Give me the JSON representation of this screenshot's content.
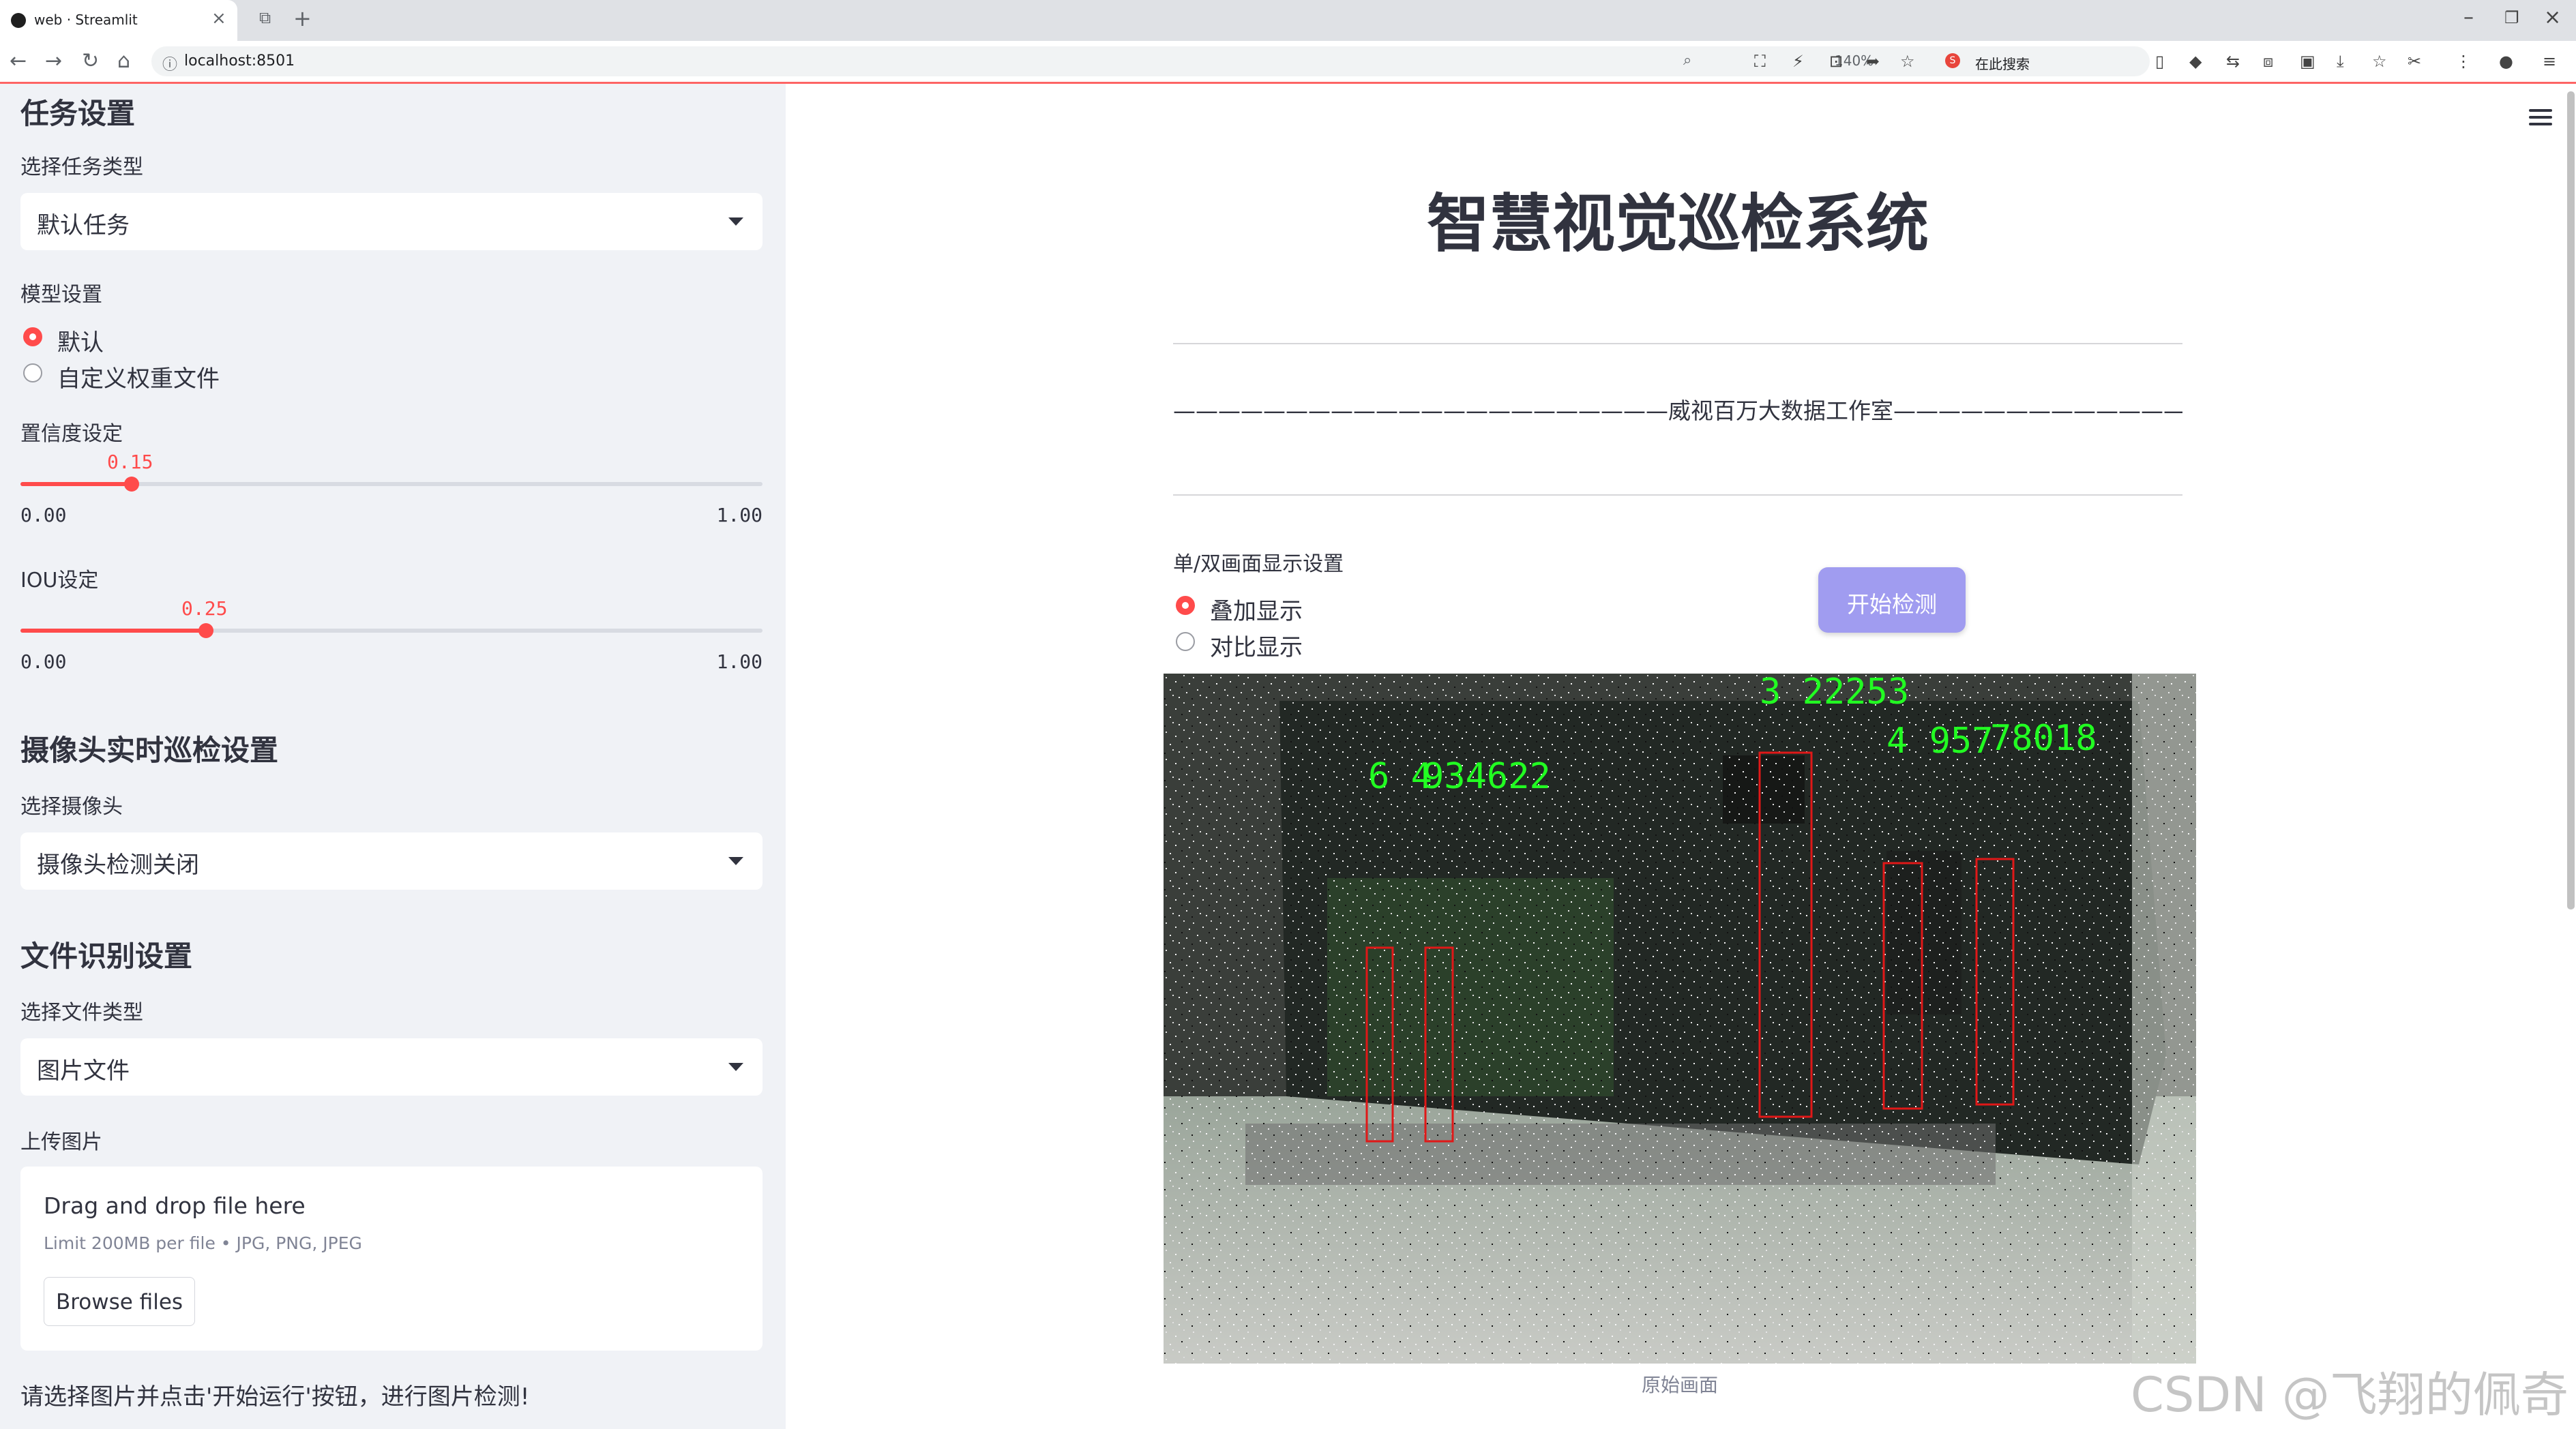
{
  "browser": {
    "tab_title": "web · Streamlit",
    "url": "localhost:8501",
    "zoom": "140%",
    "search_label": "在此搜索",
    "search_logo": "S"
  },
  "sidebar": {
    "task_section": {
      "heading": "任务设置",
      "type_label": "选择任务类型",
      "type_value": "默认任务",
      "model_label": "模型设置",
      "model_options": [
        "默认",
        "自定义权重文件"
      ],
      "model_selected": 0
    },
    "confidence": {
      "label": "置信度设定",
      "value": 0.15,
      "value_text": "0.15",
      "min": "0.00",
      "max": "1.00"
    },
    "iou": {
      "label": "IOU设定",
      "value": 0.25,
      "value_text": "0.25",
      "min": "0.00",
      "max": "1.00"
    },
    "camera_section": {
      "heading": "摄像头实时巡检设置",
      "label": "选择摄像头",
      "value": "摄像头检测关闭"
    },
    "file_section": {
      "heading": "文件识别设置",
      "type_label": "选择文件类型",
      "type_value": "图片文件",
      "upload_label": "上传图片",
      "drop_text": "Drag and drop file here",
      "limit_text": "Limit 200MB per file • JPG, PNG, JPEG",
      "browse_label": "Browse files"
    },
    "hint": "请选择图片并点击'开始运行'按钮，进行图片检测!"
  },
  "main": {
    "title": "智慧视觉巡检系统",
    "studio_line": "——————————————————————威视百万大数据工作室——————————————————————",
    "display_label": "单/双画面显示设置",
    "display_options": [
      "叠加显示",
      "对比显示"
    ],
    "display_selected": 0,
    "start_button": "开始检测",
    "image_caption": "原始画面",
    "detections": [
      {
        "label": "3 22253"
      },
      {
        "label": "4 957"
      },
      {
        "label": "78018"
      },
      {
        "label": "6 4"
      },
      {
        "label": "934622"
      }
    ]
  },
  "watermark": "CSDN @飞翔的佩奇",
  "colors": {
    "accent": "#ff4b4b",
    "button": "#a09cf0",
    "sidebar_bg": "#f0f2f6",
    "detection_box": "#e01818",
    "detection_text": "#22ff22"
  }
}
